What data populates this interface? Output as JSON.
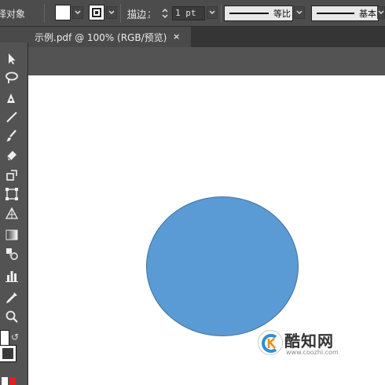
{
  "control_bar": {
    "selection_label": "择对象",
    "stroke_label": "描边",
    "stroke_colon": ":",
    "stroke_weight": "1 pt",
    "profile_uniform": "等比",
    "brush_basic": "基本"
  },
  "document": {
    "tab_title": "示例.pdf @ 100% (RGB/预览)",
    "close_glyph": "×"
  },
  "shape": {
    "fill_color": "#5b9bd5",
    "stroke_color": "#41719c"
  },
  "watermark": {
    "title": "酷知网",
    "url": "www.coozhi.com"
  },
  "icons": {
    "select": "selection-arrow-icon",
    "lasso": "lasso-icon",
    "pen": "pen-icon",
    "line": "line-segment-icon",
    "brush": "paintbrush-icon",
    "eraser": "eraser-icon",
    "rotate": "rotate-icon",
    "free_transform": "free-transform-icon",
    "perspective": "perspective-grid-icon",
    "gradient": "gradient-icon",
    "blend": "blend-icon",
    "graph": "column-graph-icon",
    "eyedropper": "eyedropper-icon",
    "zoom": "zoom-icon"
  }
}
